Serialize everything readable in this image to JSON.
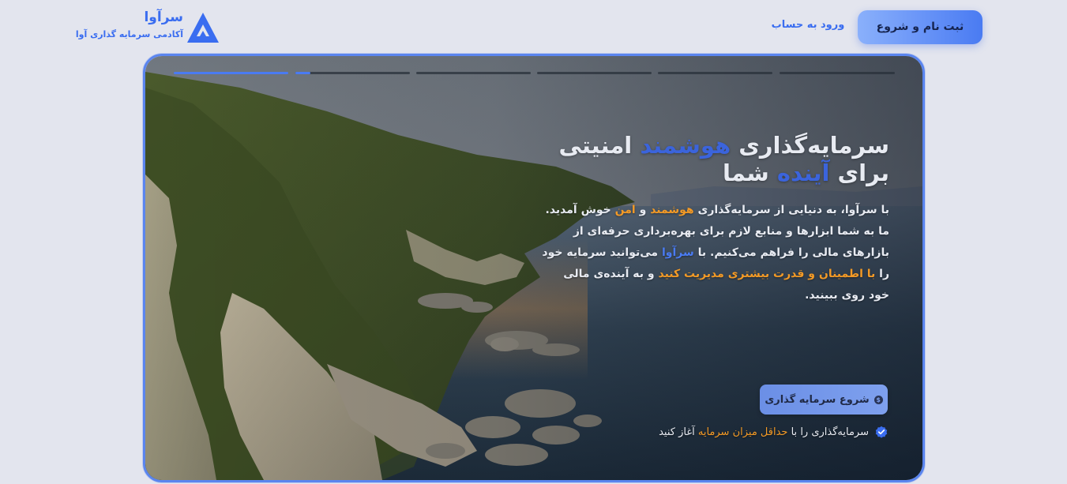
{
  "header": {
    "brand_name": "سرآوا",
    "brand_subtitle": "آکادمی سرمایه گذاری آوا",
    "logo_icon": "triangle-a-logo",
    "login_label": "ورود به حساب",
    "signup_label": "ثبت نام و شروع"
  },
  "hero": {
    "slide_progress": {
      "segments": 6,
      "active_index": 0,
      "second_segment_fill": 0.13
    },
    "title": {
      "part1": "سرمایه‌گذاری ",
      "highlight1": "هوشمند",
      "part2": " امنیتی برای ",
      "highlight2": "آینده",
      "part3": " شما"
    },
    "description": {
      "t1": "با سرآوا، به دنیایی از سرمایه‌گذاری ",
      "o1": "هوشمند",
      "t2": " و ",
      "o2": "امن",
      "t3": " خوش آمدید. ما به شما ابزارها و منابع لازم برای بهره‌برداری حرفه‌ای از بازارهای مالی را فراهم می‌کنیم. با ",
      "b1": "سرآوا",
      "t4": " می‌توانید سرمایه خود را ",
      "o3": "با اطمینان و قدرت بیشتری مدیریت کنید",
      "t5": " و به آینده‌ی مالی خود روی ببینید."
    },
    "cta_label": "شروع سرمایه گذاری",
    "cta_icon": "coin-icon",
    "note": {
      "t1": "سرمایه‌گذاری را با ",
      "highlight": "حداقل میزان سرمایه",
      "t2": " آغاز کنید"
    },
    "note_icon": "verified-check-icon"
  },
  "colors": {
    "accent_blue": "#3a6df0",
    "highlight_orange": "#f39a26",
    "page_background": "#e3e5ee"
  }
}
